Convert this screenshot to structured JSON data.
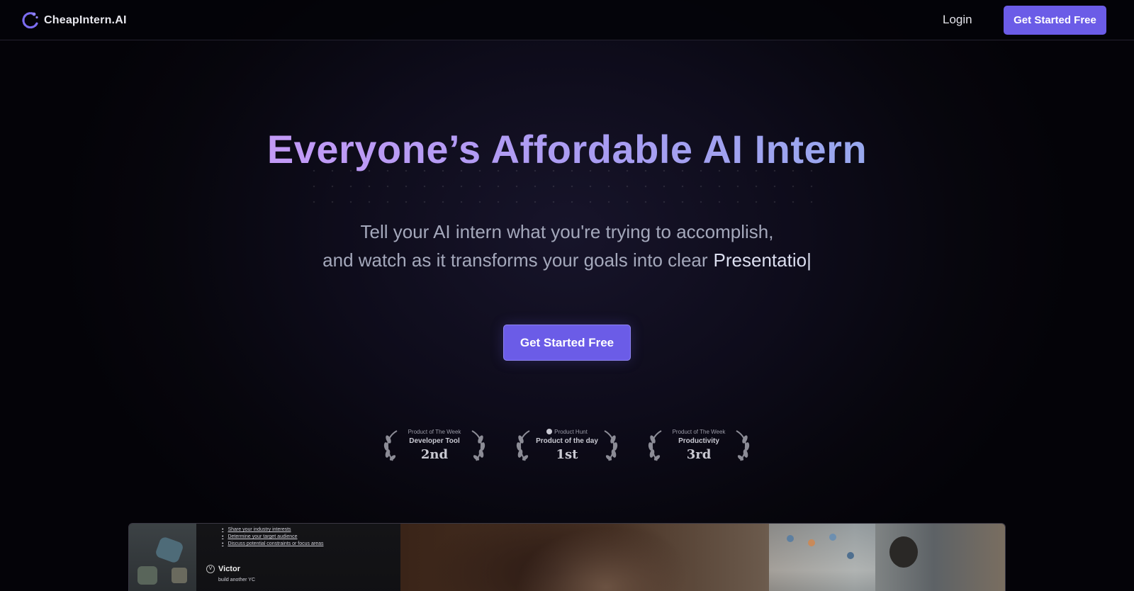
{
  "header": {
    "brand_name": "CheapIntern.AI",
    "login_label": "Login",
    "cta_label": "Get Started Free"
  },
  "hero": {
    "title": "Everyone’s Affordable AI Intern",
    "subtitle_line1": "Tell your AI intern what you're trying to accomplish,",
    "subtitle_line2": "and watch as it transforms your goals into clear",
    "typed_word": "Presentatio",
    "caret": "|",
    "cta_label": "Get Started Free"
  },
  "badges": [
    {
      "top": "Product of The Week",
      "mid": "Developer Tool",
      "rank": "2nd"
    },
    {
      "top": "Product Hunt",
      "mid": "Product of the day",
      "rank": "1st"
    },
    {
      "top": "Product of The Week",
      "mid": "Productivity",
      "rank": "3rd"
    }
  ],
  "preview": {
    "list_items": [
      "Share your industry interests",
      "Determine your target audience",
      "Discuss potential constraints or focus areas"
    ],
    "user_initial": "V",
    "user_name": "Victor",
    "user_message": "build another YC"
  },
  "colors": {
    "accent": "#6b5ce7",
    "title_gradient_start": "#c39af6",
    "title_gradient_end": "#98a8ee",
    "background": "#040308"
  }
}
